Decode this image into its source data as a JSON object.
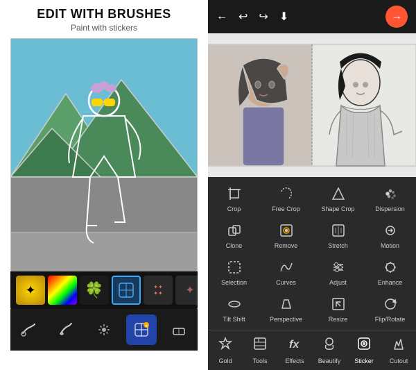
{
  "left": {
    "title": "EDIT WITH BRUSHES",
    "subtitle": "Paint with stickers",
    "stickers": [
      {
        "id": "gold",
        "type": "gold",
        "label": "Gold"
      },
      {
        "id": "rainbow",
        "type": "rainbow",
        "label": "Rainbow"
      },
      {
        "id": "clover",
        "type": "clover",
        "label": "Clover"
      },
      {
        "id": "selected",
        "type": "selected",
        "label": "Selected"
      },
      {
        "id": "confetti",
        "type": "confetti",
        "label": "Confetti"
      },
      {
        "id": "dark",
        "type": "dark",
        "label": "Dark"
      }
    ],
    "tools": [
      {
        "id": "brush1",
        "active": false
      },
      {
        "id": "brush2",
        "active": false
      },
      {
        "id": "sparkle",
        "active": false
      },
      {
        "id": "sticker",
        "active": true
      },
      {
        "id": "eraser",
        "active": false
      }
    ]
  },
  "right": {
    "nav": {
      "back": "←",
      "undo": "↩",
      "redo": "↪",
      "download": "↓",
      "next": "→"
    },
    "tools": [
      {
        "id": "crop",
        "label": "Crop"
      },
      {
        "id": "free-crop",
        "label": "Free Crop"
      },
      {
        "id": "shape-crop",
        "label": "Shape Crop"
      },
      {
        "id": "dispersion",
        "label": "Dispersion"
      },
      {
        "id": "clone",
        "label": "Clone"
      },
      {
        "id": "remove",
        "label": "Remove"
      },
      {
        "id": "stretch",
        "label": "Stretch"
      },
      {
        "id": "motion",
        "label": "Motion"
      },
      {
        "id": "selection",
        "label": "Selection"
      },
      {
        "id": "curves",
        "label": "Curves"
      },
      {
        "id": "adjust",
        "label": "Adjust"
      },
      {
        "id": "enhance",
        "label": "Enhance"
      },
      {
        "id": "tilt-shift",
        "label": "Tilt Shift"
      },
      {
        "id": "perspective",
        "label": "Perspective"
      },
      {
        "id": "resize",
        "label": "Resize"
      },
      {
        "id": "flip-rotate",
        "label": "Flip/Rotate"
      }
    ],
    "tabs": [
      {
        "id": "gold",
        "label": "Gold"
      },
      {
        "id": "tools",
        "label": "Tools"
      },
      {
        "id": "effects",
        "label": "Effects"
      },
      {
        "id": "beautify",
        "label": "Beautify"
      },
      {
        "id": "sticker",
        "label": "Sticker"
      },
      {
        "id": "cutout",
        "label": "Cutout"
      }
    ]
  }
}
